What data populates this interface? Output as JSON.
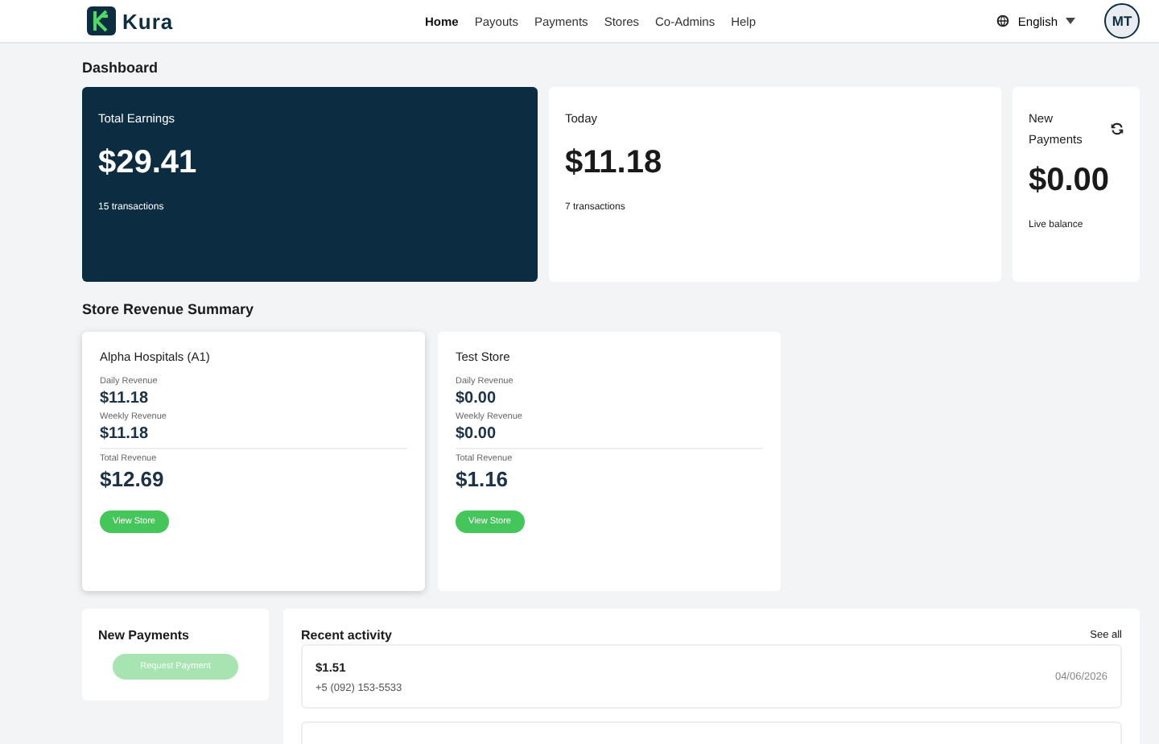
{
  "brand": {
    "name": "Kura"
  },
  "nav": [
    {
      "label": "Home",
      "selected": true
    },
    {
      "label": "Payouts",
      "selected": false
    },
    {
      "label": "Payments",
      "selected": false
    },
    {
      "label": "Stores",
      "selected": false
    },
    {
      "label": "Co-Admins",
      "selected": false
    },
    {
      "label": "Help",
      "selected": false
    }
  ],
  "language": {
    "label": "English"
  },
  "avatar": {
    "initials": "MT"
  },
  "page_title": "Dashboard",
  "stats": [
    {
      "kind": "dark",
      "title": "Total Earnings",
      "amount": "$29.41",
      "note": "15 transactions"
    },
    {
      "kind": "light",
      "title": "Today",
      "amount": "$11.18",
      "note": "7 transactions"
    },
    {
      "kind": "refresh",
      "title": "New Payments",
      "amount": "$0.00",
      "note": "Live balance"
    }
  ],
  "store_section_title": "Store Revenue Summary",
  "stores": [
    {
      "name": "Alpha Hospitals (A1)",
      "daily_label": "Daily Revenue",
      "daily": "$11.18",
      "weekly_label": "Weekly Revenue",
      "weekly": "$11.18",
      "total_label": "Total Revenue",
      "total": "$12.69",
      "button": "View Store",
      "selected": true
    },
    {
      "name": "Test Store",
      "daily_label": "Daily Revenue",
      "daily": "$0.00",
      "weekly_label": "Weekly Revenue",
      "weekly": "$0.00",
      "total_label": "Total Revenue",
      "total": "$1.16",
      "button": "View Store",
      "selected": false
    }
  ],
  "new_payments": {
    "title": "New Payments",
    "button": "Request Payment",
    "disabled": true
  },
  "recent_activity": {
    "title": "Recent activity",
    "see_all": "See all",
    "items": [
      {
        "amount": "$1.51",
        "phone": "+5 (092) 153-5533",
        "date": "04/06/2026"
      }
    ]
  }
}
